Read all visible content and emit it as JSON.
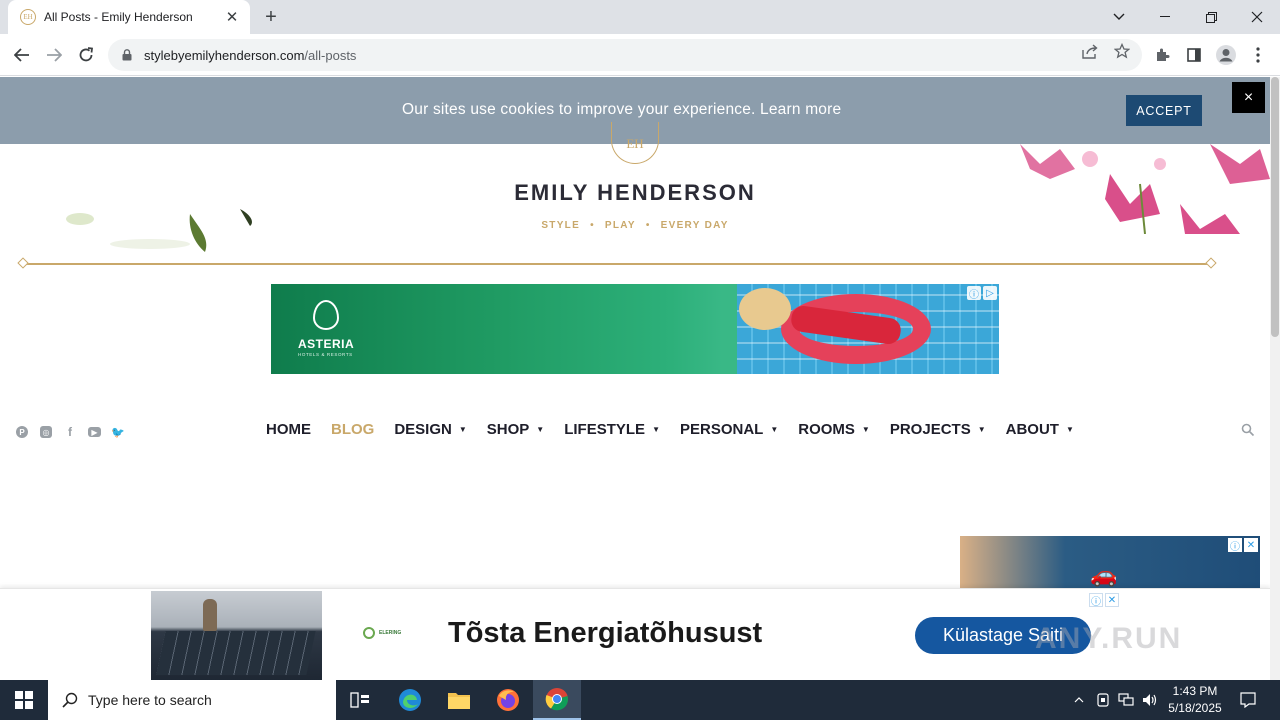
{
  "browser": {
    "tab_title": "All Posts - Emily Henderson",
    "url_host": "stylebyemilyhenderson.com",
    "url_path": "/all-posts"
  },
  "cookie": {
    "message": "Our sites use cookies to improve your experience. Learn more",
    "accept_label": "ACCEPT",
    "close_label": "×"
  },
  "logo": {
    "monogram": "EH",
    "name": "EMILY HENDERSON",
    "tag1": "STYLE",
    "tag2": "PLAY",
    "tag3": "EVERY DAY",
    "dot": "•"
  },
  "ad_top": {
    "brand": "ASTERIA",
    "sub": "HOTELS & RESORTS"
  },
  "nav": {
    "items": [
      {
        "label": "HOME",
        "dropdown": false,
        "active": false
      },
      {
        "label": "BLOG",
        "dropdown": false,
        "active": true
      },
      {
        "label": "DESIGN",
        "dropdown": true,
        "active": false
      },
      {
        "label": "SHOP",
        "dropdown": true,
        "active": false
      },
      {
        "label": "LIFESTYLE",
        "dropdown": true,
        "active": false
      },
      {
        "label": "PERSONAL",
        "dropdown": true,
        "active": false
      },
      {
        "label": "ROOMS",
        "dropdown": true,
        "active": false
      },
      {
        "label": "PROJECTS",
        "dropdown": true,
        "active": false
      },
      {
        "label": "ABOUT",
        "dropdown": true,
        "active": false
      }
    ],
    "caret": "▼"
  },
  "bottom_ad": {
    "advertiser": "ELERING",
    "headline": "Tõsta Energiatõhusust",
    "cta": "Külastage Saiti",
    "watermark": "ANY.RUN"
  },
  "taskbar": {
    "search_placeholder": "Type here to search",
    "time": "1:43 PM",
    "date": "5/18/2025"
  },
  "colors": {
    "gold": "#c9a86a",
    "cookie_bg": "#8c9dac",
    "accept_bg": "#1d4a73",
    "nav_text": "#1e1e2a",
    "cta_bg": "#1557a0"
  }
}
